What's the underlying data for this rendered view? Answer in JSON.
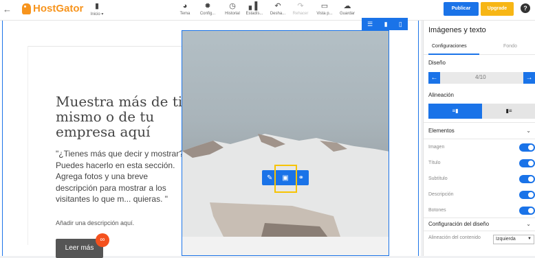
{
  "topbar": {
    "back_icon": "back-arrow-icon",
    "brand": "HostGator",
    "tools": [
      {
        "label": "Inicio ▾",
        "icon": "file-icon"
      },
      {
        "label": "Tema",
        "icon": "palette-icon"
      },
      {
        "label": "Config...",
        "icon": "gear-icon"
      },
      {
        "label": "Historial",
        "icon": "history-icon"
      },
      {
        "label": "Estadís...",
        "icon": "bar-chart-icon"
      },
      {
        "label": "Desha...",
        "icon": "undo-icon"
      },
      {
        "label": "Rehacer",
        "icon": "redo-icon"
      },
      {
        "label": "Vista p...",
        "icon": "monitor-icon"
      },
      {
        "label": "Guardar",
        "icon": "cloud-icon"
      }
    ],
    "publish_label": "Publicar",
    "upgrade_label": "Upgrade",
    "help_label": "?"
  },
  "canvas": {
    "heading": "Muestra más de ti mismo o de tu empresa aquí",
    "description": "\"¿Tienes más que decir y mostrar? Puedes hacerlo en esta sección. Agrega fotos y una breve descripción para mostrar a los visitantes lo que m... quieras. \"",
    "subdescription": "Añadir una descripción aquí.",
    "button_label": "Leer más"
  },
  "panel": {
    "title": "Imágenes y texto",
    "tabs": [
      "Configuraciones",
      "Fondo"
    ],
    "design_label": "Diseño",
    "design_value": "4/10",
    "alignment_label": "Alineación",
    "elements_label": "Elementos",
    "toggles": [
      {
        "label": "Imagen",
        "on": true
      },
      {
        "label": "Título",
        "on": true
      },
      {
        "label": "Subtítulo",
        "on": true
      },
      {
        "label": "Descripción",
        "on": true
      },
      {
        "label": "Botones",
        "on": true
      }
    ],
    "design_config_label": "Configuración del diseño",
    "content_align_label": "Alineación del contenido",
    "content_align_value": "Izquierda"
  },
  "colors": {
    "accent": "#1a73e8",
    "brand": "#f7941d",
    "upgrade": "#f7b615",
    "highlight": "#f7c300"
  }
}
